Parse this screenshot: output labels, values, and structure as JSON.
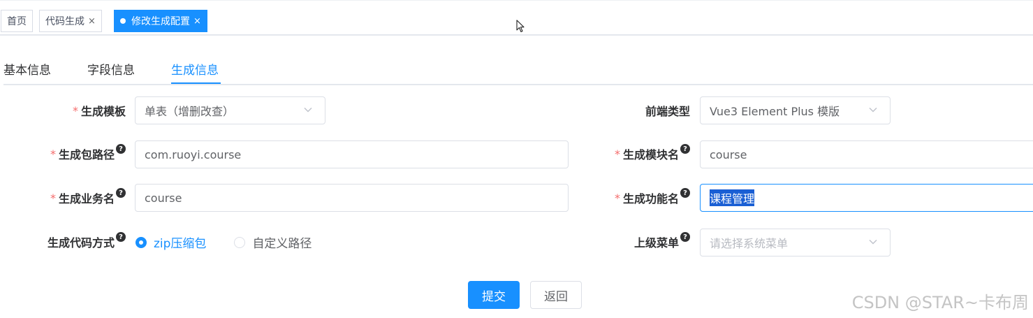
{
  "tags": [
    {
      "label": "首页",
      "closable": false,
      "active": false
    },
    {
      "label": "代码生成",
      "closable": true,
      "active": false
    },
    {
      "label": "修改生成配置",
      "closable": true,
      "active": true
    }
  ],
  "tag_close_symbol": "×",
  "tabs": [
    {
      "label": "基本信息",
      "active": false
    },
    {
      "label": "字段信息",
      "active": false
    },
    {
      "label": "生成信息",
      "active": true
    }
  ],
  "form": {
    "tpl_category": {
      "label": "生成模板",
      "value": "单表（增删改查）"
    },
    "tpl_web_type": {
      "label": "前端类型",
      "value": "Vue3 Element Plus 模版"
    },
    "package_name": {
      "label": "生成包路径",
      "value": "com.ruoyi.course"
    },
    "module_name": {
      "label": "生成模块名",
      "value": "course"
    },
    "business_name": {
      "label": "生成业务名",
      "value": "course"
    },
    "function_name": {
      "label": "生成功能名",
      "value": "课程管理"
    },
    "gen_type": {
      "label": "生成代码方式",
      "options": [
        "zip压缩包",
        "自定义路径"
      ],
      "selected": "zip压缩包"
    },
    "parent_menu": {
      "label": "上级菜单",
      "placeholder": "请选择系统菜单"
    }
  },
  "buttons": {
    "submit": "提交",
    "back": "返回"
  },
  "watermark": "CSDN @STAR~卡布周",
  "required_mark": "*",
  "help_mark": "?",
  "colors": {
    "primary": "#1890ff",
    "required": "#f56c6c"
  }
}
